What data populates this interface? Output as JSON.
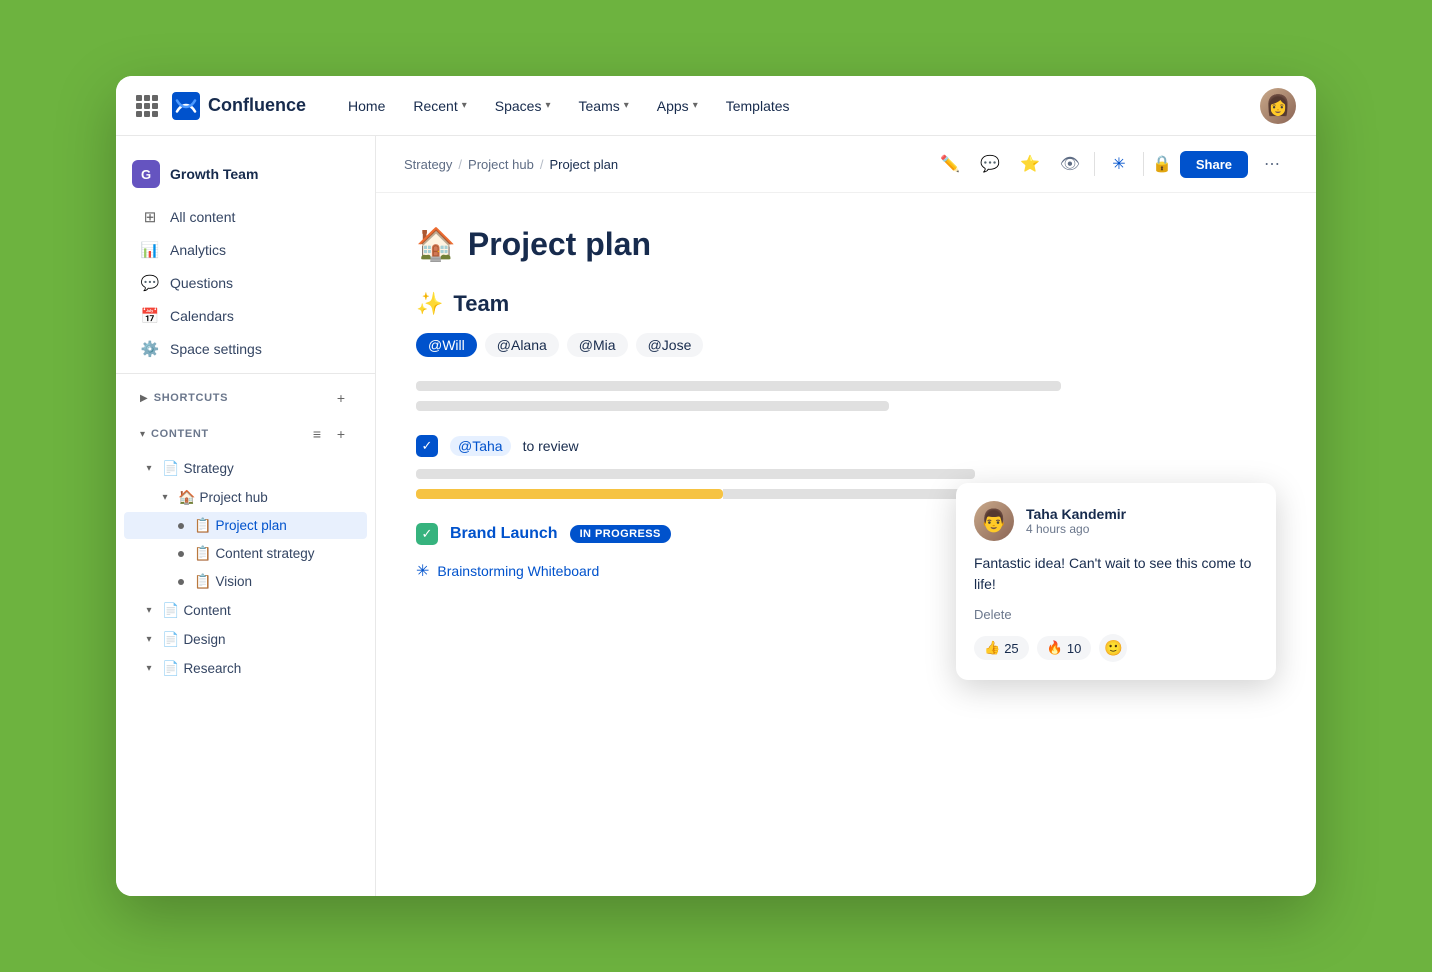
{
  "nav": {
    "home": "Home",
    "recent": "Recent",
    "spaces": "Spaces",
    "teams": "Teams",
    "apps": "Apps",
    "templates": "Templates",
    "logo_text": "Confluence"
  },
  "sidebar": {
    "space_name": "Growth Team",
    "nav_items": [
      {
        "id": "all-content",
        "label": "All content",
        "icon": "⊞"
      },
      {
        "id": "analytics",
        "label": "Analytics",
        "icon": "📊"
      },
      {
        "id": "questions",
        "label": "Questions",
        "icon": "💬"
      },
      {
        "id": "calendars",
        "label": "Calendars",
        "icon": "📅"
      },
      {
        "id": "space-settings",
        "label": "Space settings",
        "icon": "⚙️"
      }
    ],
    "shortcuts_label": "SHORTCUTS",
    "content_label": "CONTENT",
    "tree": [
      {
        "id": "strategy",
        "label": "Strategy",
        "icon": "📄",
        "level": 0,
        "expanded": true
      },
      {
        "id": "project-hub",
        "label": "Project hub",
        "icon": "🏠",
        "level": 1,
        "expanded": true
      },
      {
        "id": "project-plan",
        "label": "Project plan",
        "icon": "🟡",
        "level": 2,
        "active": true
      },
      {
        "id": "content-strategy",
        "label": "Content strategy",
        "icon": "🟡",
        "level": 2
      },
      {
        "id": "vision",
        "label": "Vision",
        "icon": "🟡",
        "level": 2
      },
      {
        "id": "content",
        "label": "Content",
        "icon": "📄",
        "level": 0
      },
      {
        "id": "design",
        "label": "Design",
        "icon": "📄",
        "level": 0
      },
      {
        "id": "research",
        "label": "Research",
        "icon": "📄",
        "level": 0
      }
    ]
  },
  "breadcrumb": {
    "items": [
      "Strategy",
      "Project hub",
      "Project plan"
    ],
    "current": "Project plan"
  },
  "page": {
    "title_emoji": "🏠",
    "title": "Project plan",
    "team_section_emoji": "✨",
    "team_section_label": "Team",
    "mentions": [
      {
        "label": "@Will",
        "primary": true
      },
      {
        "label": "@Alana",
        "primary": false
      },
      {
        "label": "@Mia",
        "primary": false
      },
      {
        "label": "@Jose",
        "primary": false
      }
    ],
    "task_mention": "@Taha",
    "task_text": "to review",
    "progress_width": "55",
    "brand_launch_label": "Brand Launch",
    "in_progress_label": "IN PROGRESS",
    "whiteboard_label": "Brainstorming Whiteboard"
  },
  "comment": {
    "author_name": "Taha Kandemir",
    "time_ago": "4 hours ago",
    "body": "Fantastic idea! Can't wait to see this come to life!",
    "delete_label": "Delete",
    "reactions": [
      {
        "emoji": "👍",
        "count": "25"
      },
      {
        "emoji": "🔥",
        "count": "10"
      }
    ]
  },
  "actions": {
    "share_label": "Share"
  }
}
